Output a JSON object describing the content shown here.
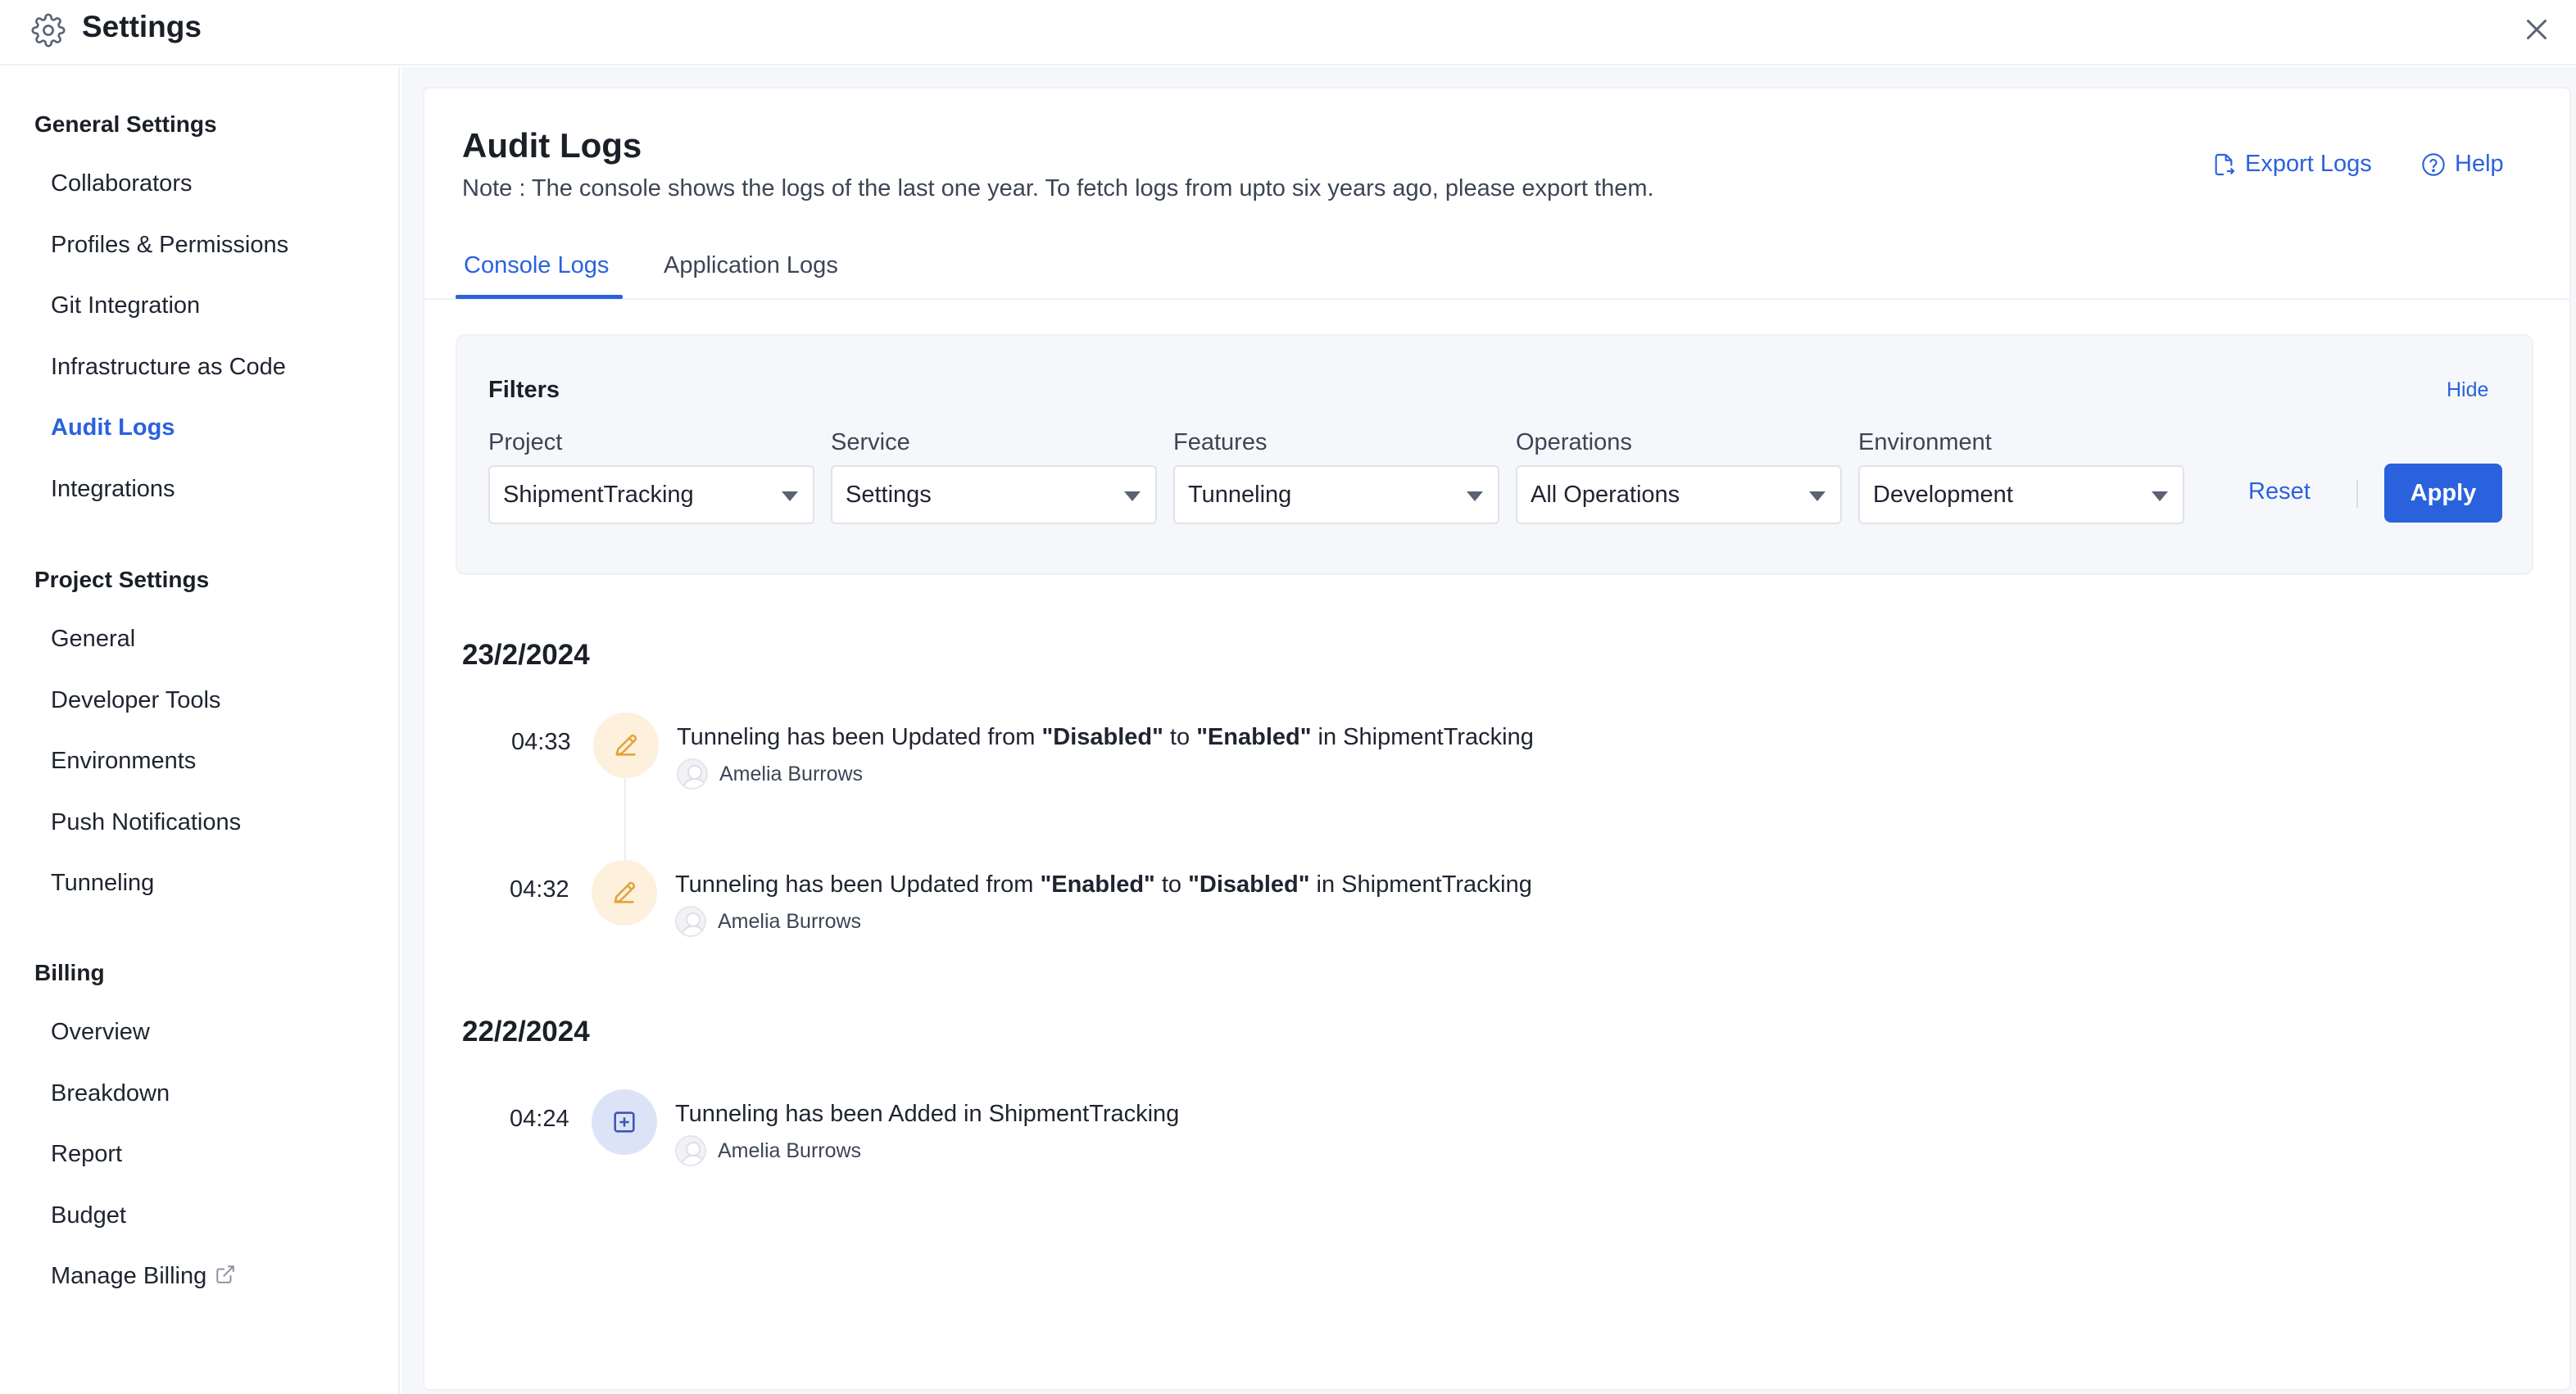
{
  "window": {
    "title": "Settings",
    "gear_icon": "gear-icon",
    "close_icon": "close-icon"
  },
  "sidebar": {
    "sections": [
      {
        "heading": "General Settings",
        "items": [
          "Collaborators",
          "Profiles & Permissions",
          "Git Integration",
          "Infrastructure as Code",
          "Audit Logs",
          "Integrations"
        ]
      },
      {
        "heading": "Project Settings",
        "items": [
          "General",
          "Developer Tools",
          "Environments",
          "Push Notifications",
          "Tunneling"
        ]
      },
      {
        "heading": "Billing",
        "items": [
          "Overview",
          "Breakdown",
          "Report",
          "Budget",
          "Manage Billing"
        ]
      }
    ],
    "active_item": "Audit Logs",
    "external_link_icon": "external-link-icon"
  },
  "page": {
    "title": "Audit Logs",
    "note": "Note : The console shows the logs of the last one year. To fetch logs from upto six years ago, please export them.",
    "export_label": "Export Logs",
    "help_label": "Help"
  },
  "tabs": [
    {
      "label": "Console Logs",
      "active": true
    },
    {
      "label": "Application Logs",
      "active": false
    }
  ],
  "filters": {
    "title": "Filters",
    "hide_label": "Hide",
    "fields": [
      {
        "label": "Project",
        "value": "ShipmentTracking"
      },
      {
        "label": "Service",
        "value": "Settings"
      },
      {
        "label": "Features",
        "value": "Tunneling"
      },
      {
        "label": "Operations",
        "value": "All Operations"
      },
      {
        "label": "Environment",
        "value": "Development"
      }
    ],
    "reset_label": "Reset",
    "apply_label": "Apply"
  },
  "logs": [
    {
      "date": "23/2/2024",
      "entries": [
        {
          "time": "04:33",
          "icon": "pencil-icon",
          "parts": [
            "Tunneling has been Updated from ",
            "\"Disabled\"",
            " to ",
            "\"Enabled\"",
            " in ShipmentTracking"
          ],
          "user": "Amelia Burrows"
        },
        {
          "time": "04:32",
          "icon": "pencil-icon",
          "parts": [
            "Tunneling has been Updated from ",
            "\"Enabled\"",
            " to ",
            "\"Disabled\"",
            " in ShipmentTracking"
          ],
          "user": "Amelia Burrows"
        }
      ]
    },
    {
      "date": "22/2/2024",
      "entries": [
        {
          "time": "04:24",
          "icon": "add-box-icon",
          "message": "Tunneling has been Added in ShipmentTracking",
          "user": "Amelia Burrows"
        }
      ]
    }
  ],
  "colors": {
    "accent": "#2a62dd",
    "edit_icon_bg": "#fdf0dc",
    "edit_icon_fg": "#e3a33a",
    "add_icon_bg": "#dde3f7",
    "add_icon_fg": "#3a56b8"
  }
}
